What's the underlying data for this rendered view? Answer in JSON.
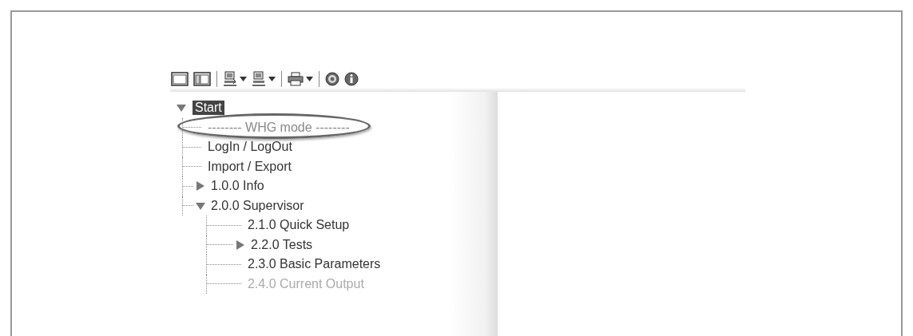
{
  "toolbar": {
    "buttons": [
      {
        "kind": "window"
      },
      {
        "kind": "split"
      },
      {
        "kind": "net-down",
        "dropdown": true
      },
      {
        "kind": "net-up",
        "dropdown": true
      },
      {
        "kind": "print",
        "dropdown": true
      },
      {
        "kind": "help"
      },
      {
        "kind": "info"
      }
    ]
  },
  "tree": [
    {
      "label": "Start",
      "selected": true,
      "expanded": true,
      "disabled": false,
      "children": [
        {
          "label": "-------- WHG mode --------",
          "selected": false,
          "disabled": true,
          "highlighted": true
        },
        {
          "label": "LogIn / LogOut",
          "selected": false,
          "disabled": false
        },
        {
          "label": "Import / Export",
          "selected": false,
          "disabled": false
        },
        {
          "label": "1.0.0 Info",
          "selected": false,
          "disabled": false,
          "expanded": false
        },
        {
          "label": "2.0.0 Supervisor",
          "selected": false,
          "disabled": false,
          "expanded": true,
          "children": [
            {
              "label": "2.1.0 Quick Setup",
              "selected": false,
              "disabled": false
            },
            {
              "label": "2.2.0 Tests",
              "selected": false,
              "disabled": false,
              "expanded": false
            },
            {
              "label": "2.3.0 Basic Parameters",
              "selected": false,
              "disabled": false
            },
            {
              "label": "2.4.0 Current Output",
              "selected": false,
              "disabled": true
            }
          ]
        }
      ]
    }
  ]
}
